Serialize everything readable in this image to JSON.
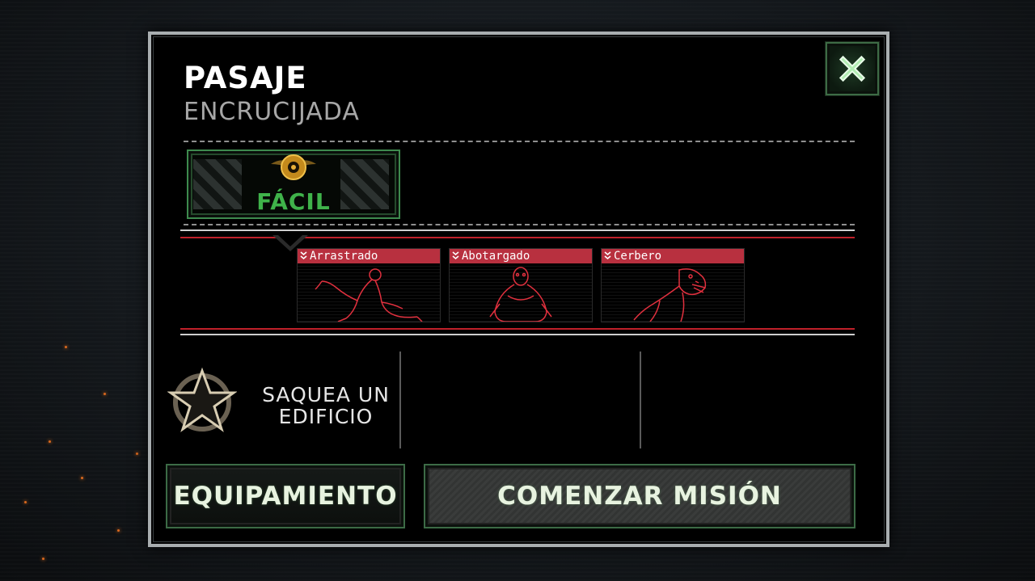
{
  "mission": {
    "title": "PASAJE",
    "subtitle": "ENCRUCIJADA"
  },
  "difficulty": {
    "label": "FÁCIL"
  },
  "enemies": [
    {
      "name": "Arrastrado"
    },
    {
      "name": "Abotargado"
    },
    {
      "name": "Cerbero"
    }
  ],
  "objective": {
    "text_line1": "SAQUEA UN",
    "text_line2": "EDIFICIO"
  },
  "buttons": {
    "equipment_label": "EQUIPAMIENTO",
    "start_label": "COMENZAR MISIÓN"
  },
  "icons": {
    "close": "close-x-icon",
    "difficulty": "winged-emblem-icon",
    "objective": "star-badge-icon",
    "enemy_tier": "double-chevron-icon"
  },
  "colors": {
    "accent_green": "#3fb24a",
    "enemy_red": "#b8303f",
    "frame_gray": "#a9aeb0"
  }
}
